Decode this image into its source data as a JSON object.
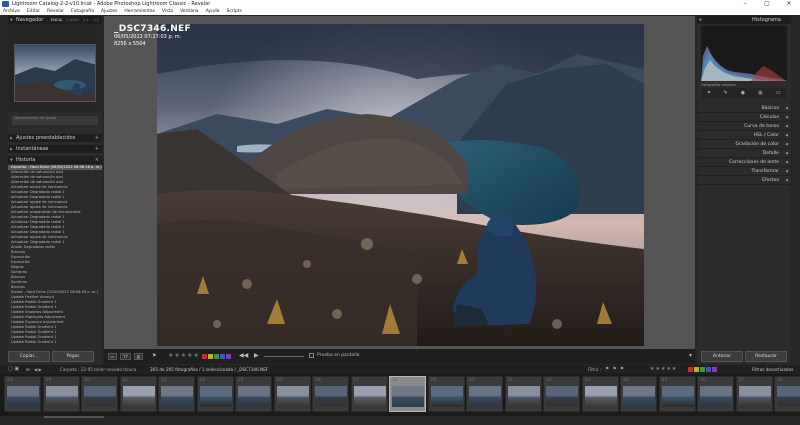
{
  "window": {
    "title": "Lightroom Catalog-2-2-v10.lrcat - Adobe Photoshop Lightroom Classic - Revelar",
    "controls": [
      "–",
      "▢",
      "✕"
    ]
  },
  "menu": [
    "Archivo",
    "Editar",
    "Revelar",
    "Fotografía",
    "Ajustes",
    "Herramientas",
    "Vista",
    "Ventana",
    "Ayuda",
    "Scripts"
  ],
  "left_panel": {
    "navigator": {
      "title": "Navegador",
      "tabs": [
        "ENCAJ",
        "LLENO",
        "1:1",
        "1:1"
      ]
    },
    "navigator_fields": [
      "Herramientas de ajuste",
      "Original",
      "Ajuste"
    ],
    "presets_title": "Ajustes preestablecidos",
    "snapshots_title": "Instantáneas",
    "history_title": "Historia",
    "history": [
      {
        "label": "Exportar - Hard Drive (06/05/2022 06:36:16 p. m.)",
        "sel": true
      },
      {
        "label": "Alteración de saturación azul"
      },
      {
        "label": "Alteración de saturación azul"
      },
      {
        "label": "Alteración de saturación azul"
      },
      {
        "label": "Actualizar ajuste de luminancia"
      },
      {
        "label": "Actualizar Degradado radial 1"
      },
      {
        "label": "Actualizar Degradado radial 1"
      },
      {
        "label": "Actualizar ajuste de luminancia"
      },
      {
        "label": "Actualizar ajuste de luminancia"
      },
      {
        "label": "Actualizar preparación de documentos"
      },
      {
        "label": "Actualizar Degradado radial 1"
      },
      {
        "label": "Actualizar Degradado radial 1"
      },
      {
        "label": "Actualizar Degradado radial 1"
      },
      {
        "label": "Actualizar Degradado radial 1"
      },
      {
        "label": "Actualizar ajuste de luminancia"
      },
      {
        "label": "Actualizar Degradado radial 1"
      },
      {
        "label": "Añadir Degradado radial"
      },
      {
        "label": "Blancos"
      },
      {
        "label": "Exposición"
      },
      {
        "label": "Exposición"
      },
      {
        "label": "Negros"
      },
      {
        "label": "Sombras"
      },
      {
        "label": "Blancos"
      },
      {
        "label": "Sombras"
      },
      {
        "label": "Blancos"
      },
      {
        "label": "Export - Hard Drive (22/05/2022 08:56:50 p. m.)"
      },
      {
        "label": "Update Feather Amount"
      },
      {
        "label": "Update Radial Gradient 1"
      },
      {
        "label": "Update Radial Gradient 1"
      },
      {
        "label": "Update Shadows Adjustment"
      },
      {
        "label": "Update Highlights Adjustment"
      },
      {
        "label": "Update Exposure Adjustment"
      },
      {
        "label": "Update Radial Gradient 1"
      },
      {
        "label": "Update Radial Gradient 1"
      },
      {
        "label": "Update Radial Gradient 1"
      },
      {
        "label": "Update Radial Gradient 1"
      }
    ],
    "copy_label": "Copiar...",
    "paste_label": "Pegar"
  },
  "photo_info": {
    "filename": "_DSC7346.NEF",
    "datetime": "06/05/2022 07:27:03 p. m.",
    "dimensions": "8256 x 5504"
  },
  "right_panel": {
    "histogram_title": "Histograma",
    "histogram_caption": "Fotografía original",
    "sections": [
      "Básicos",
      "Cálculos",
      "Curva de tonos",
      "HSL / Color",
      "Gradación de color",
      "Detalle",
      "Correcciones de lente",
      "Transformar",
      "Efectos"
    ],
    "previous_label": "Anterior",
    "reset_label": "Restaurar"
  },
  "toolbar": {
    "soft_proof_label": "Prueba en pantalla"
  },
  "filmstrip_bar": {
    "source": "Carpeta : 22-05 taller nevado toluca",
    "count": "265 de 265 fotografías / 1 seleccionada / _DSC7346.NEF",
    "filter_label": "Filtro :",
    "filter_value": "Filtros desactivados"
  },
  "filmstrip": {
    "numbers": [
      "18",
      "19",
      "20",
      "21",
      "22",
      "23",
      "24",
      "25",
      "26",
      "27",
      "28",
      "29",
      "30",
      "31",
      "32",
      "33",
      "34",
      "35",
      "36",
      "37",
      "38"
    ],
    "selected_index": 10
  }
}
